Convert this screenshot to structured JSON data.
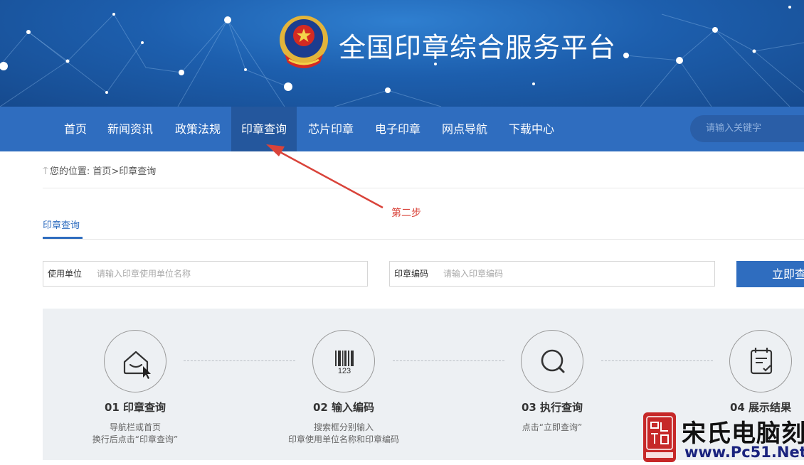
{
  "site_title": "全国印章综合服务平台",
  "nav": {
    "items": [
      "首页",
      "新闻资讯",
      "政策法规",
      "印章查询",
      "芯片印章",
      "电子印章",
      "网点导航",
      "下载中心"
    ],
    "active": "印章查询",
    "search_placeholder": "请输入关键字"
  },
  "breadcrumb": {
    "label": "您的位置:",
    "path": "首页>印章查询"
  },
  "annotation": "第二步",
  "tab_label": "印章查询",
  "form": {
    "unit_label": "使用单位",
    "unit_placeholder": "请输入印章使用单位名称",
    "code_label": "印章编码",
    "code_placeholder": "请输入印章编码",
    "submit_label": "立即查询"
  },
  "steps": [
    {
      "title": "01 印章查询",
      "desc_line1": "导航栏或首页",
      "desc_line2": "换行后点击“印章查询”",
      "icon": "house-cursor-icon"
    },
    {
      "title": "02 输入编码",
      "desc_line1": "搜索框分别输入",
      "desc_line2": "印章使用单位名称和印章编码",
      "icon": "barcode-icon"
    },
    {
      "title": "03 执行查询",
      "desc_line1": "点击“立即查询”",
      "desc_line2": "",
      "icon": "search-icon"
    },
    {
      "title": "04 展示结果",
      "desc_line1": "",
      "desc_line2": "",
      "icon": "clipboard-check-icon"
    }
  ],
  "watermark": {
    "name": "宋氏电脑刻章",
    "url": "www.Pc51.Net"
  },
  "colors": {
    "nav_bg": "#2f6dbf",
    "nav_active_bg": "#24579d",
    "accent": "#2f6dbf",
    "annotation": "#d9433a",
    "steps_bg": "#edf0f3"
  }
}
